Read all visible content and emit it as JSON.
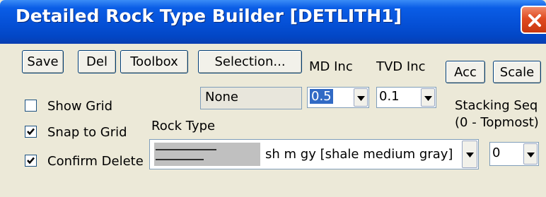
{
  "window": {
    "title": "Detailed Rock Type Builder [DETLITH1]"
  },
  "toolbar": {
    "save_label": "Save",
    "del_label": "Del",
    "toolbox_label": "Toolbox",
    "selection_label": "Selection...",
    "acc_label": "Acc",
    "scale_label": "Scale"
  },
  "increments": {
    "md_label": "MD Inc",
    "tvd_label": "TVD Inc",
    "md_value": "0.5",
    "tvd_value": "0.1"
  },
  "selection_field": {
    "value": "None"
  },
  "options": {
    "show_grid": {
      "label": "Show Grid",
      "checked": false
    },
    "snap_to_grid": {
      "label": "Snap to Grid",
      "checked": true
    },
    "confirm_delete": {
      "label": "Confirm Delete",
      "checked": true
    }
  },
  "rock_type": {
    "label": "Rock Type",
    "value": "sh m gy [shale medium gray]"
  },
  "stacking": {
    "label_line1": "Stacking Seq",
    "label_line2": "(0 - Topmost)",
    "value": "0"
  },
  "colors": {
    "title_bar": "#0550d6",
    "close_button": "#e04b22",
    "selection_highlight": "#316ac5",
    "dialog_bg": "#ece9d8"
  },
  "icons": [
    "close-icon",
    "checkmark-icon",
    "dropdown-arrow-icon",
    "rock-pattern-swatch"
  ]
}
